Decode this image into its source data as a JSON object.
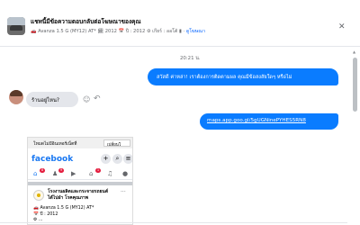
{
  "header": {
    "title": "แชทนี้มีข้อความตอบกลับต่อโฆษณาของคุณ",
    "car_details": "🚗 Avanza 1.5 G (MY12) AT* 🗓 2012 📅 ปี : 2012 ⚙ เกียร์ : ออโต้ ▮ ·",
    "ad_link": "ดูโฆษณา",
    "close_icon": "close-icon"
  },
  "messages": {
    "timestamp": "20:21 น.",
    "outgoing_greeting": "สวัสดี ค่าหล่า! เราต้องการติดตามผล คุณมีข้อสงสัยใดๆ หรือไม่",
    "incoming_question": "ร้านอยู่ไหน?",
    "outgoing_link": "maps.app.goo.gl/5gUGNinePYHES5RN8",
    "reaction_icon": "smiley-icon",
    "reply_icon": "reply-icon"
  },
  "shared_screenshot": {
    "top_label": "โหมดไม่มีอินเทอร์เน็ตที่",
    "top_button": "เปลี่ยนโ",
    "app_name": "facebook",
    "icons": [
      "plus-icon",
      "search-icon",
      "menu-icon"
    ],
    "nav_badges": [
      "8",
      "9",
      "1"
    ],
    "page_name_line1": "โรงงานผลิตและกระจายรถยนต์",
    "page_name_line2": "ได้ไปฝ่า โรคคุณภาพ",
    "car_line1": "🚗 Avanza 1.5 G (MY12) AT*",
    "car_line2": "📅 ปี : 2012",
    "car_line3": "⚙ ..."
  },
  "colors": {
    "accent": "#0a7cff",
    "link": "#0866ff",
    "facebook": "#1877f2",
    "incoming_bubble": "#e4e6eb"
  }
}
